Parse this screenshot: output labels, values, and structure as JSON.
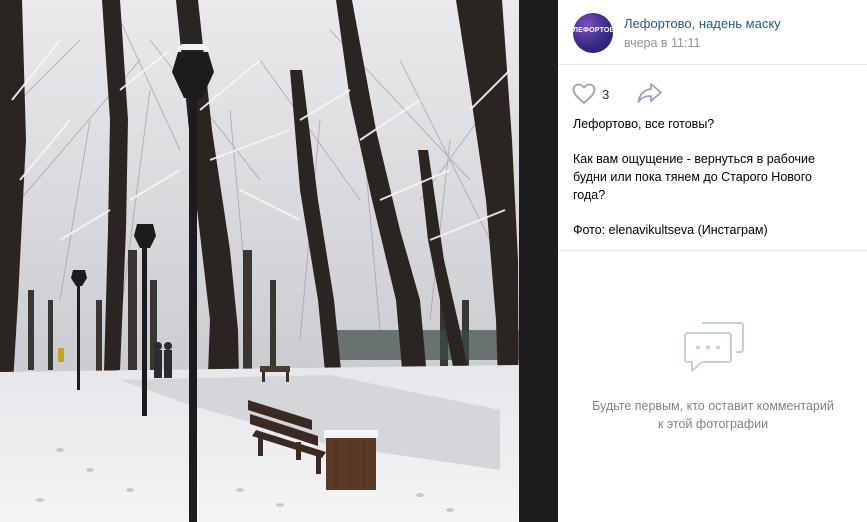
{
  "photo": {
    "description_icon": "photo-winter-park"
  },
  "post": {
    "group_name": "Лефортово, наденьмаску",
    "group_name_display": "Лефортово, надень маску",
    "avatar_text": "ЛЕФОРТОВО",
    "time": "вчера в 11:11",
    "likes": "3",
    "text_line1": "Лефортово, все готовы?",
    "text_line2": "Как вам ощущение - вернуться в рабочие будни или пока тянем до Старого Нового года?",
    "text_line3": "Фото: elenavikultseva (Инстаграм)"
  },
  "comments": {
    "empty_text": "Будьте первым, кто оставит комментарий к этой фотографии"
  },
  "icons": {
    "like": "heart-icon",
    "share": "share-arrow-icon",
    "comments_empty": "comment-bubble-icon"
  },
  "colors": {
    "link": "#2a5885",
    "muted": "#939393",
    "divider": "#e7e8ec",
    "dark_strip": "#1d1d1f"
  }
}
